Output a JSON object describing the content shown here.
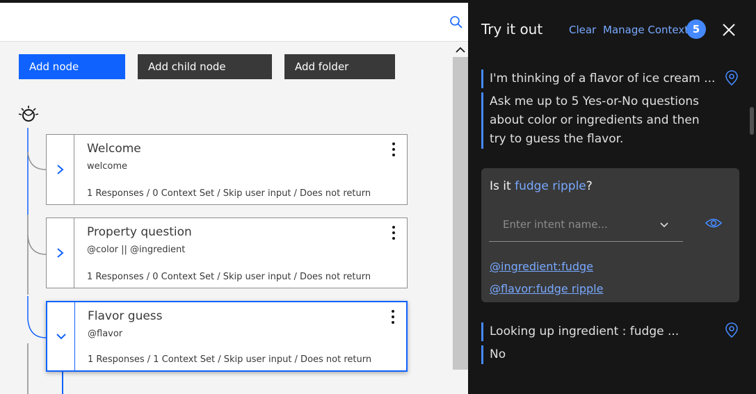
{
  "toolbar": {
    "add_node": "Add node",
    "add_child_node": "Add child node",
    "add_folder": "Add folder"
  },
  "nodes": [
    {
      "title": "Welcome",
      "condition": "welcome",
      "meta": "1 Responses / 0 Context Set / Skip user input / Does not return",
      "expanded": false
    },
    {
      "title": "Property question",
      "condition": "@color || @ingredient",
      "meta": "1 Responses / 0 Context Set / Skip user input / Does not return",
      "expanded": false
    },
    {
      "title": "Flavor guess",
      "condition": "@flavor",
      "meta": "1 Responses / 1 Context Set / Skip user input / Does not return",
      "expanded": true,
      "selected": true
    }
  ],
  "try_panel": {
    "title": "Try it out",
    "clear": "Clear",
    "manage_context": "Manage Context",
    "context_count": "5",
    "messages": {
      "bot1": "I'm thinking of a flavor of ice cream ...",
      "bot2_line1": "Ask me up to 5 Yes-or-No questions",
      "bot2_line2": "about color or ingredients and then",
      "bot2_line3": "try to guess the flavor.",
      "user_prefix": "Is it ",
      "user_highlight": "fudge ripple",
      "user_suffix": "?",
      "intent_placeholder": "Enter intent name...",
      "entities": [
        "@ingredient:fudge",
        "@flavor:fudge ripple"
      ],
      "bot3": "Looking up ingredient : fudge ...",
      "bot4": "No"
    }
  },
  "colors": {
    "primary": "#0f62fe",
    "link": "#78a9ff",
    "panel_bg": "#161616",
    "card_bg": "#393939"
  },
  "icons": {
    "search": "search-icon",
    "watson": "watson-icon",
    "close": "close-icon",
    "location": "location-pin-icon",
    "eye": "eye-icon",
    "chevron": "chevron-down-icon"
  }
}
